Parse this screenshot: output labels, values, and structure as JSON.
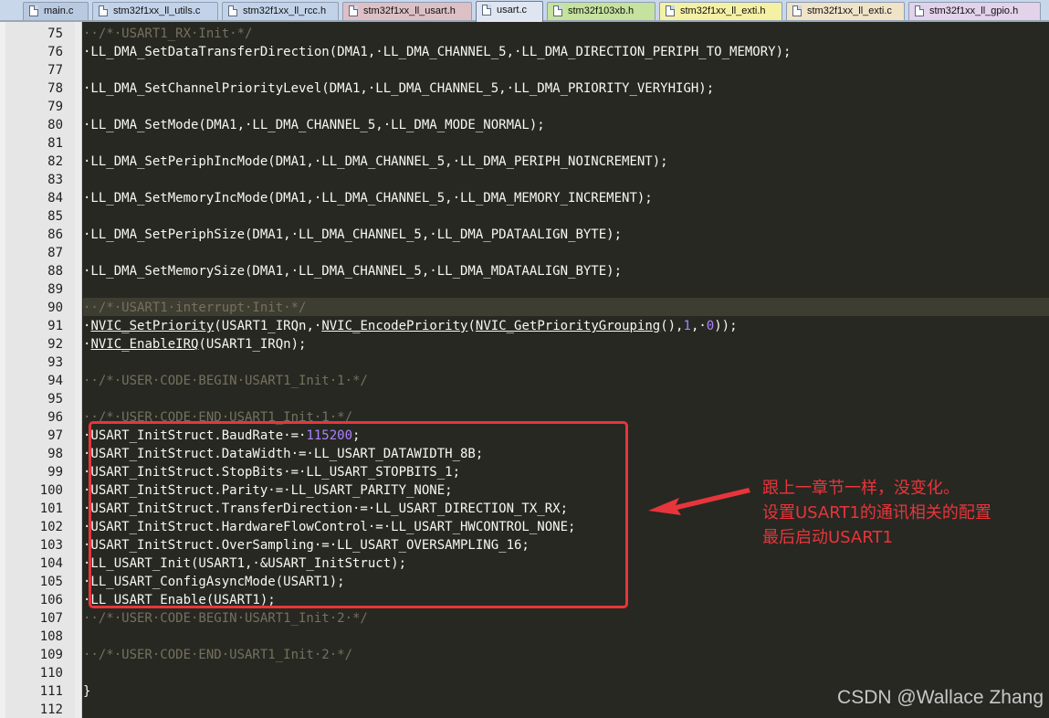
{
  "tabs": [
    {
      "label": "main.c",
      "color": "#b9c9e0",
      "active": false
    },
    {
      "label": "stm32f1xx_ll_utils.c",
      "color": "#c2d2e8",
      "active": false
    },
    {
      "label": "stm32f1xx_ll_rcc.h",
      "color": "#c2d2e8",
      "active": false
    },
    {
      "label": "stm32f1xx_ll_usart.h",
      "color": "#ddc0c6",
      "active": false
    },
    {
      "label": "usart.c",
      "color": "#dfe6f1",
      "active": true
    },
    {
      "label": "stm32f103xb.h",
      "color": "#c5e29e",
      "active": false
    },
    {
      "label": "stm32f1xx_ll_exti.h",
      "color": "#f5f1a4",
      "active": false
    },
    {
      "label": "stm32f1xx_ll_exti.c",
      "color": "#efe3c8",
      "active": false
    },
    {
      "label": "stm32f1xx_ll_gpio.h",
      "color": "#e2d2ea",
      "active": false
    }
  ],
  "editor": {
    "highlighted_line": "90",
    "lines": [
      {
        "n": "75",
        "parts": [
          {
            "t": "··/*·USART1_RX·Init·*/",
            "c": "comment"
          }
        ]
      },
      {
        "n": "76",
        "parts": [
          {
            "t": "·LL_DMA_SetDataTransferDirection(DMA1,·LL_DMA_CHANNEL_5,·LL_DMA_DIRECTION_PERIPH_TO_MEMORY);",
            "c": ""
          }
        ]
      },
      {
        "n": "77",
        "parts": []
      },
      {
        "n": "78",
        "parts": [
          {
            "t": "·LL_DMA_SetChannelPriorityLevel(DMA1,·LL_DMA_CHANNEL_5,·LL_DMA_PRIORITY_VERYHIGH);",
            "c": ""
          }
        ]
      },
      {
        "n": "79",
        "parts": []
      },
      {
        "n": "80",
        "parts": [
          {
            "t": "·LL_DMA_SetMode(DMA1,·LL_DMA_CHANNEL_5,·LL_DMA_MODE_NORMAL);",
            "c": ""
          }
        ]
      },
      {
        "n": "81",
        "parts": []
      },
      {
        "n": "82",
        "parts": [
          {
            "t": "·LL_DMA_SetPeriphIncMode(DMA1,·LL_DMA_CHANNEL_5,·LL_DMA_PERIPH_NOINCREMENT);",
            "c": ""
          }
        ]
      },
      {
        "n": "83",
        "parts": []
      },
      {
        "n": "84",
        "parts": [
          {
            "t": "·LL_DMA_SetMemoryIncMode(DMA1,·LL_DMA_CHANNEL_5,·LL_DMA_MEMORY_INCREMENT);",
            "c": ""
          }
        ]
      },
      {
        "n": "85",
        "parts": []
      },
      {
        "n": "86",
        "parts": [
          {
            "t": "·LL_DMA_SetPeriphSize(DMA1,·LL_DMA_CHANNEL_5,·LL_DMA_PDATAALIGN_BYTE);",
            "c": ""
          }
        ]
      },
      {
        "n": "87",
        "parts": []
      },
      {
        "n": "88",
        "parts": [
          {
            "t": "·LL_DMA_SetMemorySize(DMA1,·LL_DMA_CHANNEL_5,·LL_DMA_MDATAALIGN_BYTE);",
            "c": ""
          }
        ]
      },
      {
        "n": "89",
        "parts": []
      },
      {
        "n": "90",
        "parts": [
          {
            "t": "··/*·USART1·interrupt·Init·*/",
            "c": "comment"
          }
        ]
      },
      {
        "n": "91",
        "parts": [
          {
            "t": "·",
            "c": ""
          },
          {
            "t": "NVIC_SetPriority",
            "c": "ul"
          },
          {
            "t": "(USART1_IRQn,·",
            "c": ""
          },
          {
            "t": "NVIC_EncodePriority",
            "c": "ul"
          },
          {
            "t": "(",
            "c": ""
          },
          {
            "t": "NVIC_GetPriorityGrouping",
            "c": "ul"
          },
          {
            "t": "(),",
            "c": ""
          },
          {
            "t": "1",
            "c": "num"
          },
          {
            "t": ",·",
            "c": ""
          },
          {
            "t": "0",
            "c": "num"
          },
          {
            "t": "));",
            "c": ""
          }
        ]
      },
      {
        "n": "92",
        "parts": [
          {
            "t": "·",
            "c": ""
          },
          {
            "t": "NVIC_EnableIRQ",
            "c": "ul"
          },
          {
            "t": "(USART1_IRQn);",
            "c": ""
          }
        ]
      },
      {
        "n": "93",
        "parts": []
      },
      {
        "n": "94",
        "parts": [
          {
            "t": "··/*·USER·CODE·BEGIN·USART1_Init·1·*/",
            "c": "comment"
          }
        ]
      },
      {
        "n": "95",
        "parts": []
      },
      {
        "n": "96",
        "parts": [
          {
            "t": "··/*·USER·CODE·END·USART1_Init·1·*/",
            "c": "comment"
          }
        ]
      },
      {
        "n": "97",
        "parts": [
          {
            "t": "·USART_InitStruct.BaudRate·=·",
            "c": ""
          },
          {
            "t": "115200",
            "c": "num"
          },
          {
            "t": ";",
            "c": ""
          }
        ]
      },
      {
        "n": "98",
        "parts": [
          {
            "t": "·USART_InitStruct.DataWidth·=·LL_USART_DATAWIDTH_8B;",
            "c": ""
          }
        ]
      },
      {
        "n": "99",
        "parts": [
          {
            "t": "·USART_InitStruct.StopBits·=·LL_USART_STOPBITS_1;",
            "c": ""
          }
        ]
      },
      {
        "n": "100",
        "parts": [
          {
            "t": "·USART_InitStruct.Parity·=·LL_USART_PARITY_NONE;",
            "c": ""
          }
        ]
      },
      {
        "n": "101",
        "parts": [
          {
            "t": "·USART_InitStruct.TransferDirection·=·LL_USART_DIRECTION_TX_RX;",
            "c": ""
          }
        ]
      },
      {
        "n": "102",
        "parts": [
          {
            "t": "·USART_InitStruct.HardwareFlowControl·=·LL_USART_HWCONTROL_NONE;",
            "c": ""
          }
        ]
      },
      {
        "n": "103",
        "parts": [
          {
            "t": "·USART_InitStruct.OverSampling·=·LL_USART_OVERSAMPLING_16;",
            "c": ""
          }
        ]
      },
      {
        "n": "104",
        "parts": [
          {
            "t": "·LL_USART_Init(USART1,·&USART_InitStruct);",
            "c": ""
          }
        ]
      },
      {
        "n": "105",
        "parts": [
          {
            "t": "·LL_USART_ConfigAsyncMode(USART1);",
            "c": ""
          }
        ]
      },
      {
        "n": "106",
        "parts": [
          {
            "t": "·LL_USART_Enable(USART1);",
            "c": ""
          }
        ]
      },
      {
        "n": "107",
        "parts": [
          {
            "t": "··/*·USER·CODE·BEGIN·USART1_Init·2·*/",
            "c": "comment"
          }
        ]
      },
      {
        "n": "108",
        "parts": []
      },
      {
        "n": "109",
        "parts": [
          {
            "t": "··/*·USER·CODE·END·USART1_Init·2·*/",
            "c": "comment"
          }
        ]
      },
      {
        "n": "110",
        "parts": []
      },
      {
        "n": "111",
        "parts": [
          {
            "t": "}",
            "c": ""
          }
        ]
      },
      {
        "n": "112",
        "parts": []
      }
    ]
  },
  "annotation": {
    "color": "#e8353b",
    "lines": [
      "跟上一章节一样，没变化。",
      "设置USART1的通讯相关的配置",
      "最后启动USART1"
    ]
  },
  "watermark": "CSDN @Wallace Zhang"
}
